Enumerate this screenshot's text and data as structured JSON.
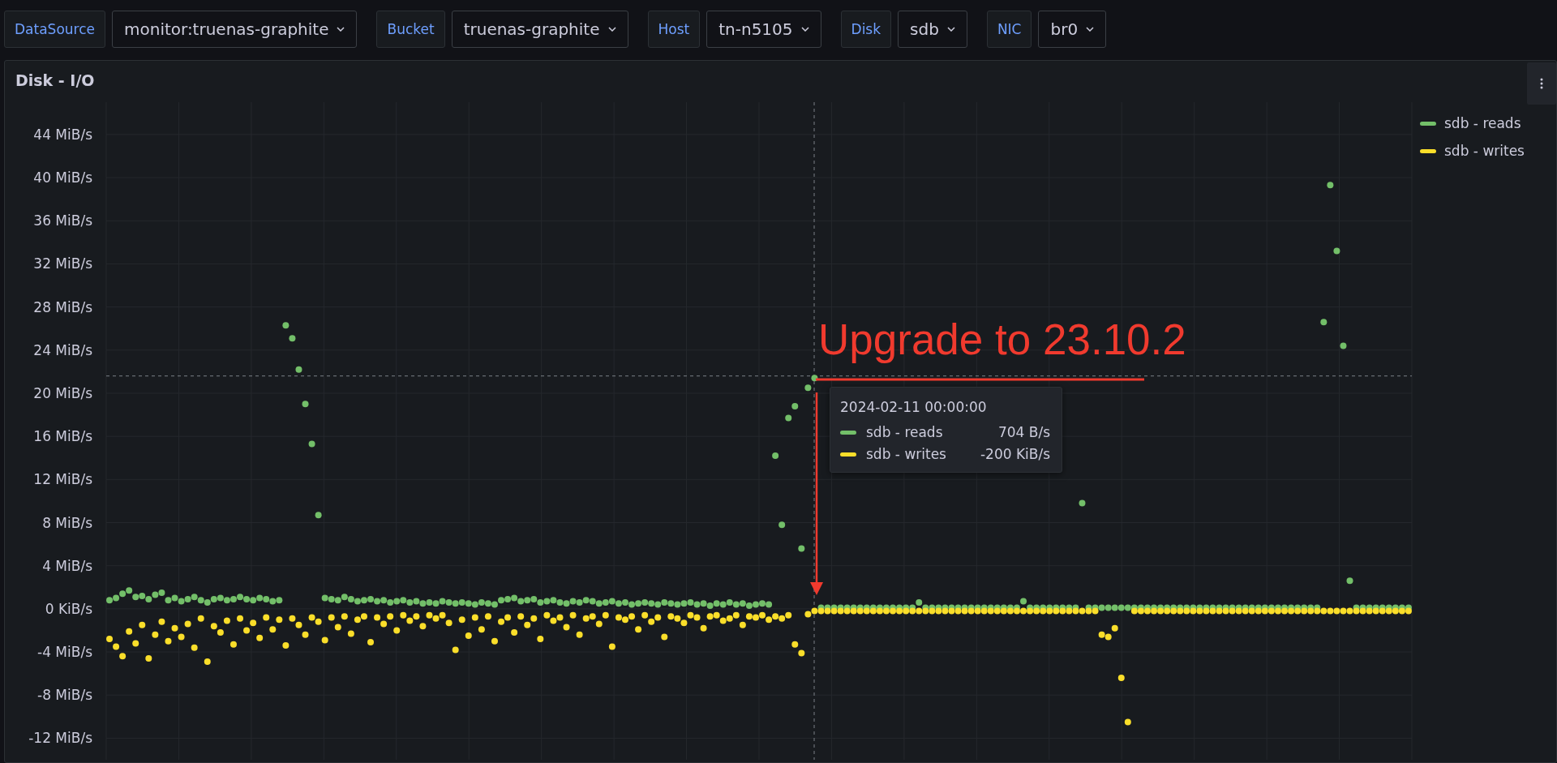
{
  "variables": [
    {
      "label": "DataSource",
      "value": "monitor:truenas-graphite"
    },
    {
      "label": "Bucket",
      "value": "truenas-graphite"
    },
    {
      "label": "Host",
      "value": "tn-n5105"
    },
    {
      "label": "Disk",
      "value": "sdb"
    },
    {
      "label": "NIC",
      "value": "br0"
    }
  ],
  "panel": {
    "title": "Disk - I/O",
    "chart_data": {
      "type": "scatter",
      "grid": true,
      "ylim": [
        -14,
        47
      ],
      "ref_lines": [
        {
          "axis": "y",
          "value": 21.6
        }
      ],
      "yticks": [
        {
          "value": 44,
          "label": "44 MiB/s"
        },
        {
          "value": 40,
          "label": "40 MiB/s"
        },
        {
          "value": 36,
          "label": "36 MiB/s"
        },
        {
          "value": 32,
          "label": "32 MiB/s"
        },
        {
          "value": 28,
          "label": "28 MiB/s"
        },
        {
          "value": 24,
          "label": "24 MiB/s"
        },
        {
          "value": 20,
          "label": "20 MiB/s"
        },
        {
          "value": 16,
          "label": "16 MiB/s"
        },
        {
          "value": 12,
          "label": "12 MiB/s"
        },
        {
          "value": 8,
          "label": "8 MiB/s"
        },
        {
          "value": 4,
          "label": "4 MiB/s"
        },
        {
          "value": 0,
          "label": "0 KiB/s"
        },
        {
          "value": -4,
          "label": "-4 MiB/s"
        },
        {
          "value": -8,
          "label": "-8 MiB/s"
        },
        {
          "value": -12,
          "label": "-12 MiB/s"
        }
      ],
      "categories": [
        null,
        null,
        null,
        null,
        null,
        null,
        null,
        null,
        null,
        null,
        null,
        null,
        null,
        null,
        null,
        null,
        null,
        null,
        null,
        null,
        null,
        null,
        null,
        null,
        null,
        null,
        null,
        null,
        null,
        null,
        null,
        null,
        null,
        null,
        null,
        null,
        null,
        null,
        null,
        null,
        null,
        null,
        null,
        null,
        null,
        null,
        null,
        null,
        null,
        null,
        null,
        null,
        null,
        null,
        null,
        null,
        null,
        null,
        null,
        null,
        null,
        null,
        null,
        null,
        null,
        null,
        null,
        null,
        null,
        null,
        null,
        null,
        null,
        null,
        null,
        null,
        null,
        null,
        null,
        null,
        null,
        null,
        null,
        null,
        null,
        null,
        null,
        null,
        null,
        null,
        null,
        null,
        null,
        null,
        null,
        null,
        null,
        null,
        null,
        null,
        null,
        null,
        null,
        null,
        null,
        null,
        null,
        null,
        null,
        null,
        null,
        null,
        null,
        null,
        null,
        null,
        null,
        null,
        null,
        null,
        null,
        null,
        null,
        null,
        null,
        null,
        null,
        null,
        null,
        null,
        null,
        null,
        null,
        null,
        null,
        null,
        null,
        null,
        null,
        null,
        null,
        null,
        null,
        null,
        null,
        null,
        null,
        null,
        null,
        null,
        null,
        null,
        null,
        null,
        null,
        null,
        null,
        null,
        null,
        null,
        null,
        null,
        null,
        null,
        null,
        null,
        null,
        null,
        null,
        null,
        null,
        null,
        null,
        null,
        null,
        null,
        null,
        null,
        null,
        null,
        null,
        null,
        null,
        null,
        null,
        null,
        null,
        null,
        null,
        null,
        null,
        null,
        null,
        null,
        null,
        null,
        null,
        null,
        null,
        null
      ],
      "series": [
        {
          "name": "sdb - reads",
          "color": "#73bf69",
          "values": [
            0.8,
            1.0,
            1.4,
            1.7,
            1.1,
            1.2,
            0.9,
            1.3,
            1.5,
            0.8,
            1.0,
            0.7,
            0.9,
            1.1,
            0.8,
            0.6,
            0.9,
            1.0,
            0.8,
            0.9,
            1.1,
            0.9,
            0.8,
            1.0,
            0.9,
            0.7,
            0.8,
            26.3,
            25.1,
            22.2,
            19.0,
            15.3,
            8.7,
            1.0,
            0.9,
            0.8,
            1.1,
            0.9,
            0.7,
            0.8,
            0.9,
            0.7,
            0.8,
            0.6,
            0.7,
            0.8,
            0.6,
            0.7,
            0.5,
            0.6,
            0.5,
            0.7,
            0.6,
            0.5,
            0.6,
            0.5,
            0.4,
            0.6,
            0.5,
            0.4,
            0.8,
            0.9,
            1.0,
            0.7,
            0.8,
            0.9,
            0.6,
            0.7,
            0.8,
            0.6,
            0.5,
            0.7,
            0.6,
            0.8,
            0.7,
            0.5,
            0.6,
            0.7,
            0.5,
            0.6,
            0.4,
            0.5,
            0.6,
            0.5,
            0.4,
            0.6,
            0.5,
            0.4,
            0.5,
            0.6,
            0.4,
            0.5,
            0.3,
            0.5,
            0.4,
            0.6,
            0.4,
            0.5,
            0.3,
            0.4,
            0.5,
            0.4,
            14.2,
            7.8,
            17.7,
            18.8,
            5.6,
            20.5,
            21.4,
            0.1,
            0.1,
            0.1,
            0.1,
            0.1,
            0.1,
            0.1,
            0.1,
            0.1,
            0.1,
            0.1,
            0.1,
            0.1,
            0.1,
            0.1,
            0.6,
            0.1,
            0.1,
            0.1,
            0.1,
            0.1,
            0.1,
            0.1,
            0.1,
            0.1,
            0.1,
            0.1,
            0.1,
            0.1,
            0.1,
            0.1,
            0.7,
            0.1,
            0.1,
            0.1,
            0.1,
            0.1,
            0.1,
            0.1,
            0.1,
            9.8,
            0.1,
            0.1,
            0.1,
            0.1,
            0.1,
            0.1,
            0.1,
            0.1,
            0.1,
            0.1,
            0.1,
            0.1,
            0.1,
            0.1,
            0.1,
            0.1,
            0.1,
            0.1,
            0.1,
            0.1,
            0.1,
            0.1,
            0.1,
            0.1,
            0.1,
            0.1,
            0.1,
            0.1,
            0.1,
            0.1,
            0.1,
            0.1,
            0.1,
            0.1,
            0.1,
            0.1,
            26.6,
            39.3,
            33.2,
            24.4,
            2.6,
            0.1,
            0.1,
            0.1,
            0.1,
            0.1,
            0.1,
            0.1,
            0.1,
            0.1
          ]
        },
        {
          "name": "sdb - writes",
          "color": "#fade2a",
          "values": [
            -2.8,
            -3.5,
            -4.4,
            -2.1,
            -3.2,
            -1.5,
            -4.6,
            -2.4,
            -1.2,
            -3.0,
            -1.8,
            -2.6,
            -1.4,
            -3.6,
            -0.9,
            -4.9,
            -1.6,
            -2.2,
            -1.1,
            -3.3,
            -0.9,
            -2.0,
            -1.3,
            -2.7,
            -0.8,
            -1.9,
            -1.0,
            -3.4,
            -0.9,
            -1.5,
            -2.4,
            -0.8,
            -1.2,
            -2.9,
            -0.8,
            -1.7,
            -0.7,
            -2.3,
            -1.0,
            -0.7,
            -3.1,
            -0.8,
            -1.4,
            -0.7,
            -2.0,
            -0.6,
            -1.1,
            -0.7,
            -1.6,
            -0.6,
            -0.9,
            -0.6,
            -1.3,
            -3.8,
            -1.0,
            -2.5,
            -0.8,
            -1.9,
            -0.7,
            -3.0,
            -1.2,
            -0.8,
            -2.2,
            -0.7,
            -1.5,
            -0.9,
            -2.8,
            -0.6,
            -1.1,
            -0.8,
            -1.7,
            -0.6,
            -2.4,
            -0.9,
            -0.7,
            -1.4,
            -0.6,
            -3.5,
            -0.8,
            -1.0,
            -0.7,
            -1.9,
            -0.6,
            -1.2,
            -0.8,
            -2.6,
            -0.7,
            -0.9,
            -1.3,
            -0.6,
            -0.8,
            -1.8,
            -0.7,
            -0.6,
            -1.1,
            -0.9,
            -0.6,
            -1.5,
            -0.7,
            -0.8,
            -0.6,
            -1.0,
            -0.7,
            -0.9,
            -0.6,
            -3.3,
            -4.1,
            -0.5,
            -0.2,
            -0.2,
            -0.2,
            -0.2,
            -0.2,
            -0.2,
            -0.2,
            -0.2,
            -0.2,
            -0.2,
            -0.2,
            -0.2,
            -0.2,
            -0.2,
            -0.2,
            -0.2,
            -0.2,
            -0.2,
            -0.2,
            -0.2,
            -0.2,
            -0.2,
            -0.2,
            -0.2,
            -0.2,
            -0.2,
            -0.2,
            -0.2,
            -0.2,
            -0.2,
            -0.2,
            -0.2,
            -0.2,
            -0.2,
            -0.2,
            -0.2,
            -0.2,
            -0.2,
            -0.2,
            -0.2,
            -0.2,
            -0.2,
            -0.2,
            -0.2,
            -2.4,
            -2.6,
            -1.8,
            -6.4,
            -10.5,
            -0.2,
            -0.2,
            -0.2,
            -0.2,
            -0.2,
            -0.2,
            -0.2,
            -0.2,
            -0.2,
            -0.2,
            -0.2,
            -0.2,
            -0.2,
            -0.2,
            -0.2,
            -0.2,
            -0.2,
            -0.2,
            -0.2,
            -0.2,
            -0.2,
            -0.2,
            -0.2,
            -0.2,
            -0.2,
            -0.2,
            -0.2,
            -0.2,
            -0.2,
            -0.2,
            -0.2,
            -0.2,
            -0.2,
            -0.2,
            -0.2,
            -0.2,
            -0.2,
            -0.2,
            -0.2,
            -0.2,
            -0.2,
            -0.2,
            -0.2
          ]
        }
      ]
    },
    "tooltip": {
      "time": "2024-02-11 00:00:00",
      "rows": [
        {
          "name": "sdb - reads",
          "value": "704 B/s",
          "color": "#73bf69"
        },
        {
          "name": "sdb - writes",
          "value": "-200 KiB/s",
          "color": "#fade2a"
        }
      ]
    },
    "markup": {
      "text": "Upgrade to 23.10.2"
    }
  }
}
